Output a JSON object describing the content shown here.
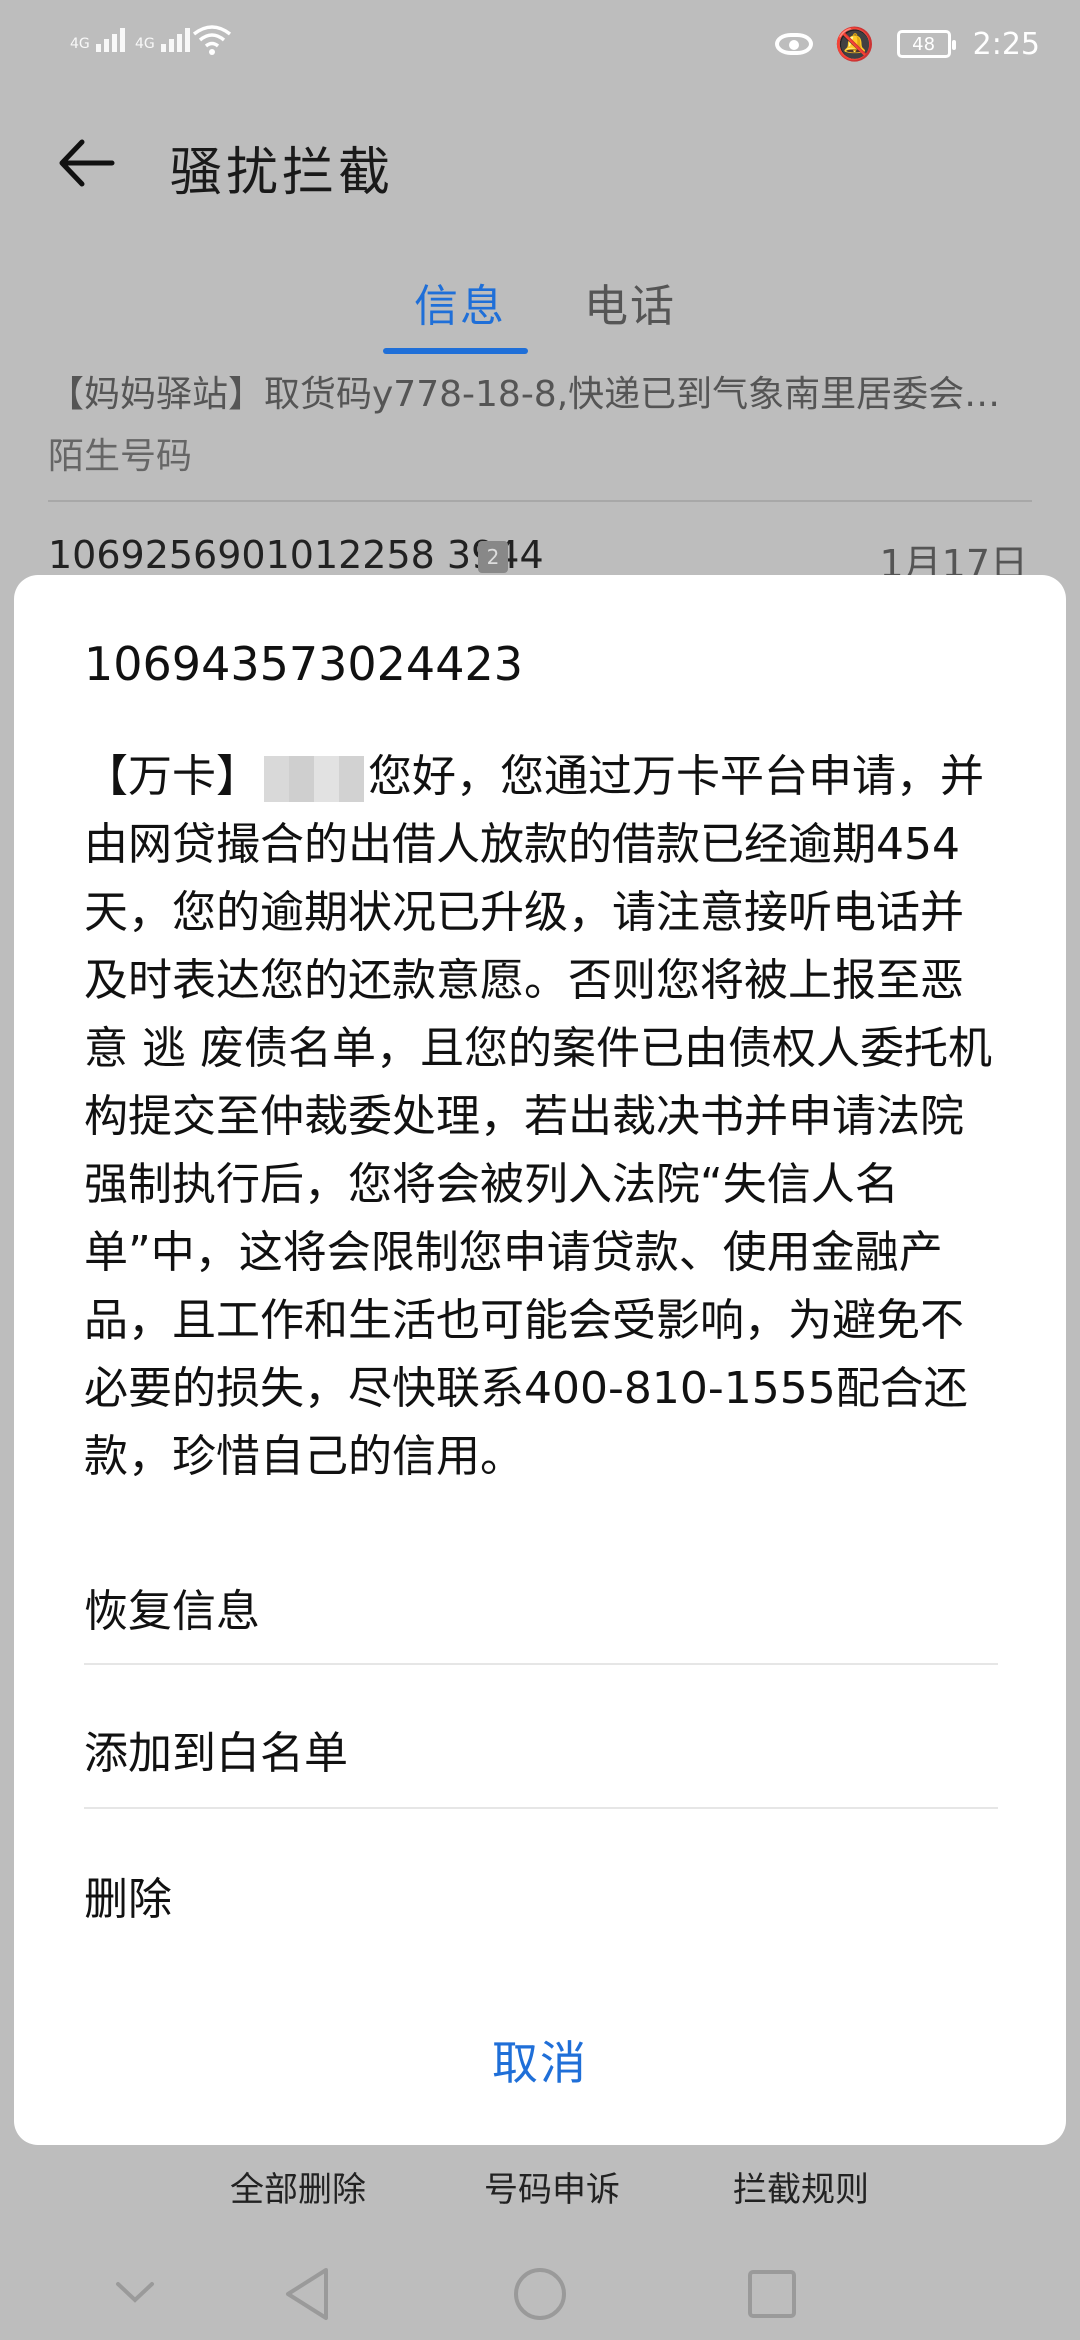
{
  "status_bar": {
    "signal1": "4G",
    "signal2": "4G",
    "battery": "48",
    "time": "2:25"
  },
  "header": {
    "title": "骚扰拦截"
  },
  "tabs": [
    {
      "label": "信息",
      "active": true
    },
    {
      "label": "电话",
      "active": false
    }
  ],
  "list": [
    {
      "text": "【妈妈驿站】取货码y778-18-8,快递已到气象南里居委会…",
      "subtitle": "陌生号码"
    },
    {
      "number": "1069256901012258 3944",
      "badge": "2",
      "date": "1月17日"
    }
  ],
  "dialog": {
    "sender": "106943573024423",
    "message_prefix": "【万卡】",
    "message_body": "您好，您通过万卡平台申请，并由网贷撮合的出借人放款的借款已经逾期454天，您的逾期状况已升级，请注意接听电话并及时表达您的还款意愿。否则您将被上报至恶意 逃 废债名单，且您的案件已由债权人委托机构提交至仲裁委处理，若出裁决书并申请法院强制执行后，您将会被列入法院“失信人名单”中，这将会限制您申请贷款、使用金融产品，且工作和生活也可能会受影响，为避免不必要的损失，尽快联系400-810-1555配合还款，珍惜自己的信用。",
    "options": [
      "恢复信息",
      "添加到白名单",
      "删除"
    ],
    "cancel_label": "取消"
  },
  "bottom_actions": [
    "全部删除",
    "号码申诉",
    "拦截规则"
  ],
  "accent_color": "#1f6fd8"
}
